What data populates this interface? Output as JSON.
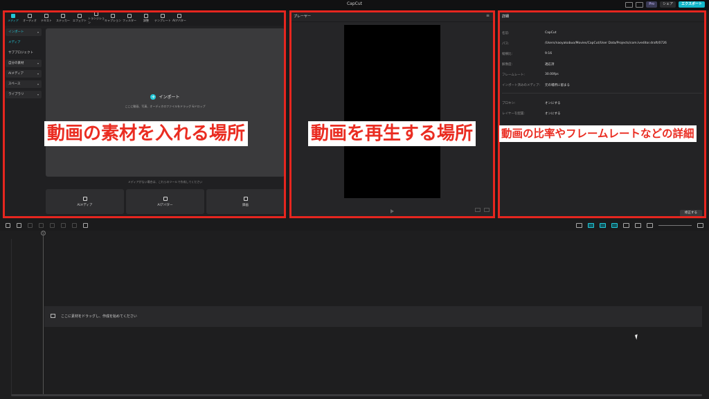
{
  "app": {
    "title": "CapCut"
  },
  "titlebar": {
    "pro_label": "Pro",
    "share_label": "シェア",
    "export_label": "エクスポート"
  },
  "media": {
    "toolbar": [
      {
        "label": "メディア",
        "icon": "media-icon",
        "active": true
      },
      {
        "label": "オーディオ",
        "icon": "audio-icon"
      },
      {
        "label": "テキスト",
        "icon": "text-icon"
      },
      {
        "label": "ステッカー",
        "icon": "sticker-icon"
      },
      {
        "label": "エフェクト",
        "icon": "effect-icon"
      },
      {
        "label": "トランジション",
        "icon": "transition-icon"
      },
      {
        "label": "キャプション",
        "icon": "caption-icon"
      },
      {
        "label": "フィルター",
        "icon": "filter-icon"
      },
      {
        "label": "調整",
        "icon": "adjust-icon"
      },
      {
        "label": "テンプレート",
        "icon": "template-icon"
      },
      {
        "label": "AIアバター",
        "icon": "ai-avatar-icon"
      }
    ],
    "nav": [
      {
        "label": "インポート",
        "dropdown": true,
        "active": true
      },
      {
        "label": "メディア",
        "plain": true,
        "active": true
      },
      {
        "label": "サブプロジェクト",
        "plain": true
      },
      {
        "label": "自分の素材",
        "dropdown": true
      },
      {
        "label": "AIメディア",
        "dropdown": true
      },
      {
        "label": "スペース",
        "dropdown": true
      },
      {
        "label": "ライブラリ",
        "dropdown": true
      }
    ],
    "import_label": "インポート",
    "import_hint": "ここに動画、写真、オーディオのファイルをドラッグ &ドロップ",
    "tool_hint": "メディアがない場合は、これらのツールで作成してください",
    "tool_cards": [
      {
        "label": "AIメディア"
      },
      {
        "label": "AIアバター"
      },
      {
        "label": "録画"
      }
    ]
  },
  "player": {
    "header": "プレーヤー"
  },
  "details": {
    "header": "詳細",
    "rows": [
      {
        "key": "名前:",
        "value": "CapCut"
      },
      {
        "key": "パス:",
        "value": "/Users/naoyakobuo/Movies/CapCut/User Data/Projects/com.lveditor.draft/0726"
      },
      {
        "key": "縦横比:",
        "value": "9:16"
      },
      {
        "key": "解像度:",
        "value": "適応済"
      },
      {
        "key": "フレームレート:",
        "value": "30.00fps"
      },
      {
        "key": "インポート済みのメディア:",
        "value": "元の場所に留まる"
      }
    ],
    "rows2": [
      {
        "key": "プロキシ:",
        "value": "オンにする"
      },
      {
        "key": "レイヤーを配置:",
        "value": "オンにする"
      }
    ],
    "edit_label": "修正する"
  },
  "overlays": {
    "media": "動画の素材を入れる場所",
    "player": "動画を再生する場所",
    "details": "動画の比率やフレームレートなどの詳細"
  },
  "timeline": {
    "playhead_time": "0",
    "drop_hint": "ここに素材をドラッグし、作成を始めてください"
  },
  "colors": {
    "accent": "#23c8d8",
    "highlight_frame": "#e6261f",
    "callout_text": "#ea2d22"
  }
}
